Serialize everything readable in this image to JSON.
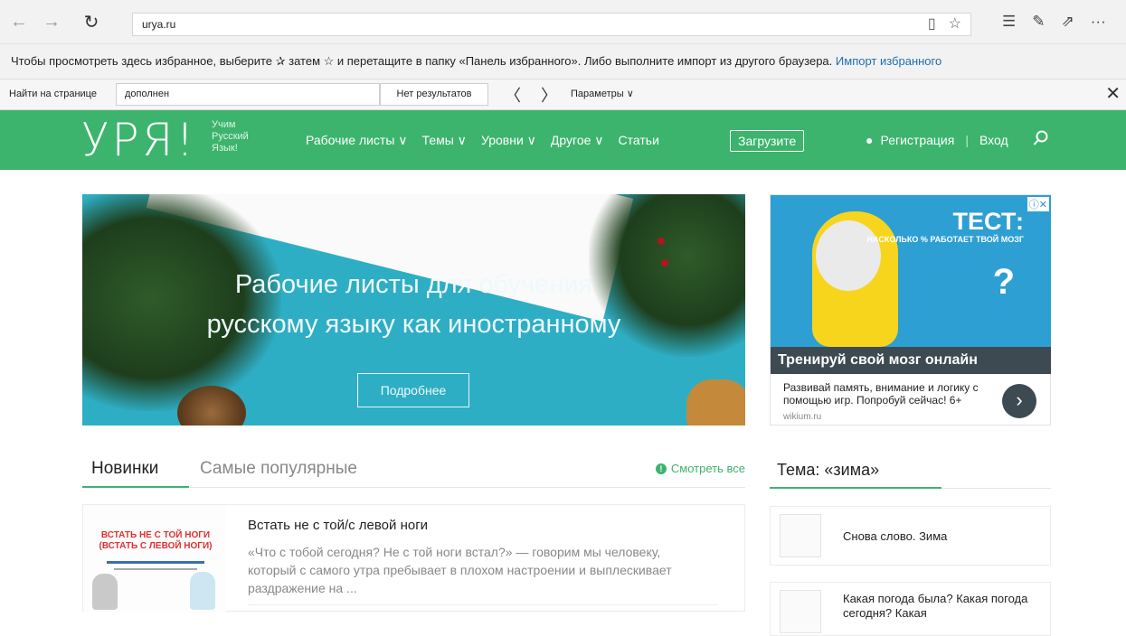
{
  "browser": {
    "url": "urya.ru",
    "favorites_bar_text": "Чтобы просмотреть здесь избранное, выберите ✰ затем ☆ и перетащите в папку «Панель избранного». Либо выполните импорт из другого браузера.",
    "import_link": "Импорт избранного"
  },
  "find_bar": {
    "label": "Найти на странице",
    "query": "дополнен",
    "result": "Нет результатов",
    "params": "Параметры ∨"
  },
  "site_header": {
    "logo": "УРЯ!",
    "tagline": [
      "Учим",
      "Русский",
      "Язык!"
    ],
    "nav": [
      "Рабочие листы ∨",
      "Темы ∨",
      "Уровни ∨",
      "Другое ∨",
      "Статьи"
    ],
    "upload": "Загрузите",
    "register": "Регистрация",
    "login": "Вход"
  },
  "hero": {
    "title_line1": "Рабочие листы для обучения",
    "title_line2": "русскому языку как иностранному",
    "button": "Подробнее"
  },
  "ad": {
    "headline": "ТЕСТ:",
    "subline": "НАСКОЛЬКО % РАБОТАЕТ ТВОЙ МОЗГ",
    "question": "?",
    "title": "Тренируй свой мозг онлайн",
    "text": "Развивай память, внимание и логику с помощью игр. Попробуй сейчас! 6+",
    "domain": "wikium.ru"
  },
  "tabs": {
    "new": "Новинки",
    "popular": "Самые популярные",
    "see_all": "Смотреть все"
  },
  "article": {
    "thumb_title": "ВСТАТЬ НЕ С ТОЙ НОГИ (ВСТАТЬ С ЛЕВОЙ НОГИ)",
    "title": "Встать не с той/с левой ноги",
    "excerpt": "«Что с тобой сегодня? Не с той ноги встал?» — говорим мы человеку, который с самого утра пребывает в плохом настроении и выплескивает раздражение на ..."
  },
  "topic": {
    "title": "Тема: «зима»",
    "items": [
      "Снова слово. Зима",
      "Какая погода была? Какая погода сегодня? Какая"
    ]
  },
  "colors": {
    "brand_green": "#3cb46e",
    "hero_blue": "#2eaec4",
    "link_blue": "#1f6fb2"
  }
}
